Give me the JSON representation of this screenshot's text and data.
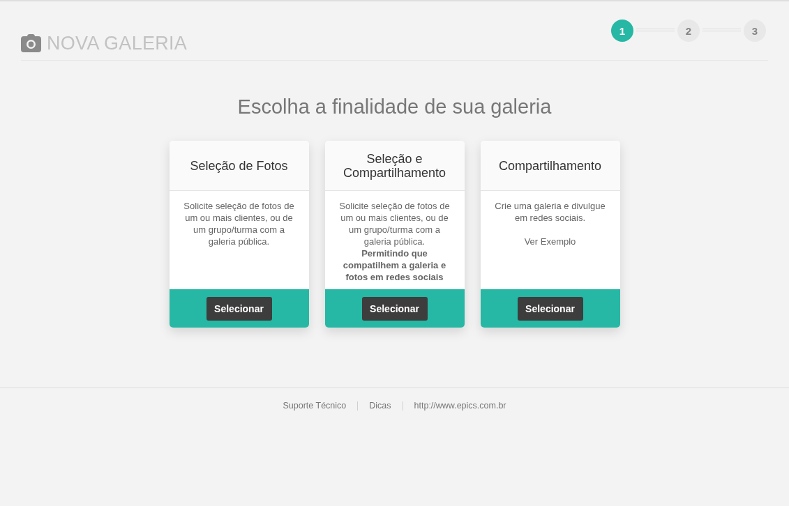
{
  "header": {
    "title": "NOVA GALERIA"
  },
  "steps": [
    {
      "label": "1",
      "active": true
    },
    {
      "label": "2",
      "active": false
    },
    {
      "label": "3",
      "active": false
    }
  ],
  "heading": "Escolha a finalidade de sua galeria",
  "cards": [
    {
      "title": "Seleção de Fotos",
      "description": "Solicite seleção de fotos de um ou mais clientes, ou de um grupo/turma com a galeria pública.",
      "button": "Selecionar"
    },
    {
      "title": "Seleção e Compartilhamento",
      "description": "Solicite seleção de fotos de um ou mais clientes, ou de um grupo/turma com a galeria pública.",
      "note": "Permitindo que compatilhem a galeria e fotos em redes sociais",
      "button": "Selecionar"
    },
    {
      "title": "Compartilhamento",
      "description": "Crie uma galeria e divulgue em redes sociais.",
      "link": "Ver Exemplo",
      "button": "Selecionar"
    }
  ],
  "footer_links": [
    "Suporte Técnico",
    "Dicas",
    "http://www.epics.com.br"
  ]
}
